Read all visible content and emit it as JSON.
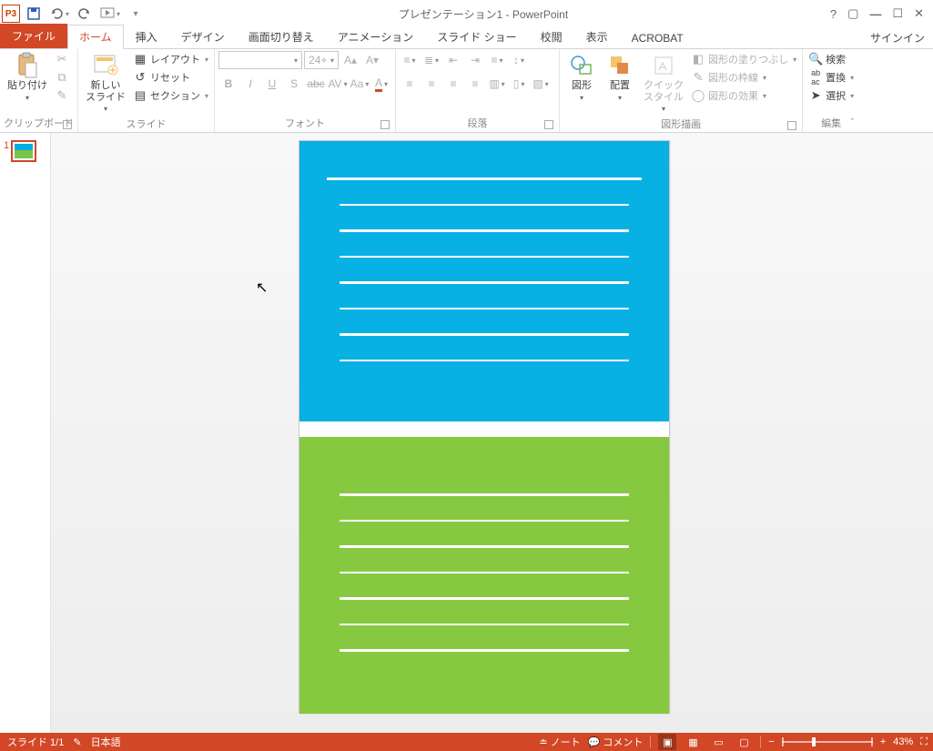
{
  "title": "プレゼンテーション1 - PowerPoint",
  "qat": {
    "app": "P3"
  },
  "tabs": {
    "file": "ファイル",
    "items": [
      "ホーム",
      "挿入",
      "デザイン",
      "画面切り替え",
      "アニメーション",
      "スライド ショー",
      "校閲",
      "表示",
      "ACROBAT"
    ],
    "active": "ホーム",
    "signin": "サインイン"
  },
  "ribbon": {
    "clipboard": {
      "label": "クリップボード",
      "paste": "貼り付け"
    },
    "slides": {
      "label": "スライド",
      "new": "新しい\nスライド",
      "layout": "レイアウト",
      "reset": "リセット",
      "section": "セクション"
    },
    "font": {
      "label": "フォント",
      "size": "24+"
    },
    "para": {
      "label": "段落"
    },
    "drawing": {
      "label": "図形描画",
      "shapes": "図形",
      "arrange": "配置",
      "quick": "クイック\nスタイル",
      "fill": "図形の塗りつぶし",
      "outline": "図形の枠線",
      "effects": "図形の効果"
    },
    "editing": {
      "label": "編集",
      "find": "検索",
      "replace": "置換",
      "select": "選択"
    }
  },
  "thumbs": {
    "num": "1"
  },
  "status": {
    "slide": "スライド 1/1",
    "lang": "日本語",
    "notes": "ノート",
    "comments": "コメント",
    "zoom": "43%"
  }
}
